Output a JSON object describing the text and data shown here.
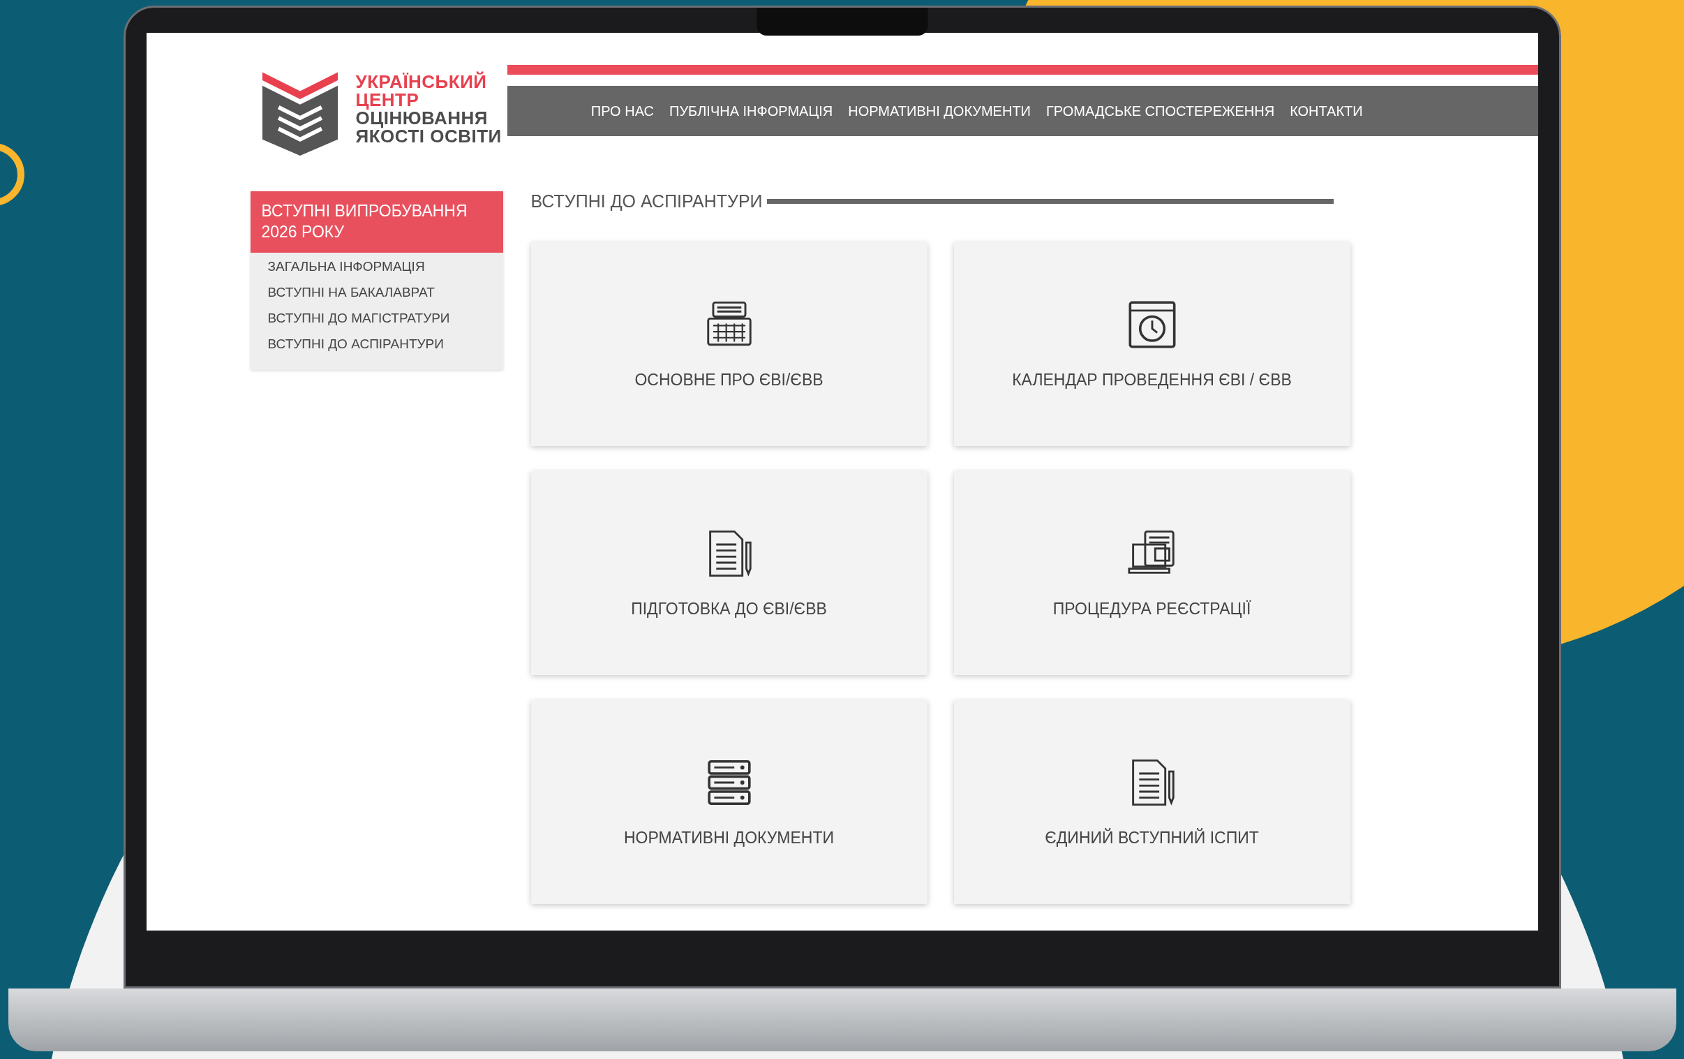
{
  "logo": {
    "line_1": "УКРАЇНСЬКИЙ",
    "line_2": "ЦЕНТР",
    "line_3": "ОЦІНЮВАННЯ",
    "line_4": "ЯКОСТІ ОСВІТИ"
  },
  "nav": [
    "ПРО НАС",
    "ПУБЛІЧНА ІНФОРМАЦІЯ",
    "НОРМАТИВНІ ДОКУМЕНТИ",
    "ГРОМАДСЬКЕ СПОСТЕРЕЖЕННЯ",
    "КОНТАКТИ"
  ],
  "sidebar": {
    "heading": "ВСТУПНІ ВИПРОБУВАННЯ 2026 РОКУ",
    "items": [
      "ЗАГАЛЬНА ІНФОРМАЦІЯ",
      "ВСТУПНІ НА БАКАЛАВРАТ",
      "ВСТУПНІ ДО МАГІСТРАТУРИ",
      "ВСТУПНІ ДО АСПІРАНТУРИ"
    ]
  },
  "section_title": "ВСТУПНІ ДО АСПІРАНТУРИ",
  "cards": [
    {
      "title": "ОСНОВНЕ ПРО ЄВІ/ЄВВ",
      "kind": "keyboard"
    },
    {
      "title": "КАЛЕНДАР ПРОВЕДЕННЯ ЄВІ / ЄВВ",
      "kind": "clock"
    },
    {
      "title": "ПІДГОТОВКА ДО ЄВІ/ЄВВ",
      "kind": "document"
    },
    {
      "title": "ПРОЦЕДУРА РЕЄСТРАЦІЇ",
      "kind": "laptop"
    },
    {
      "title": "НОРМАТИВНІ ДОКУМЕНТИ",
      "kind": "server"
    },
    {
      "title": "ЄДИНИЙ ВСТУПНИЙ ІСПИТ",
      "kind": "document"
    }
  ]
}
